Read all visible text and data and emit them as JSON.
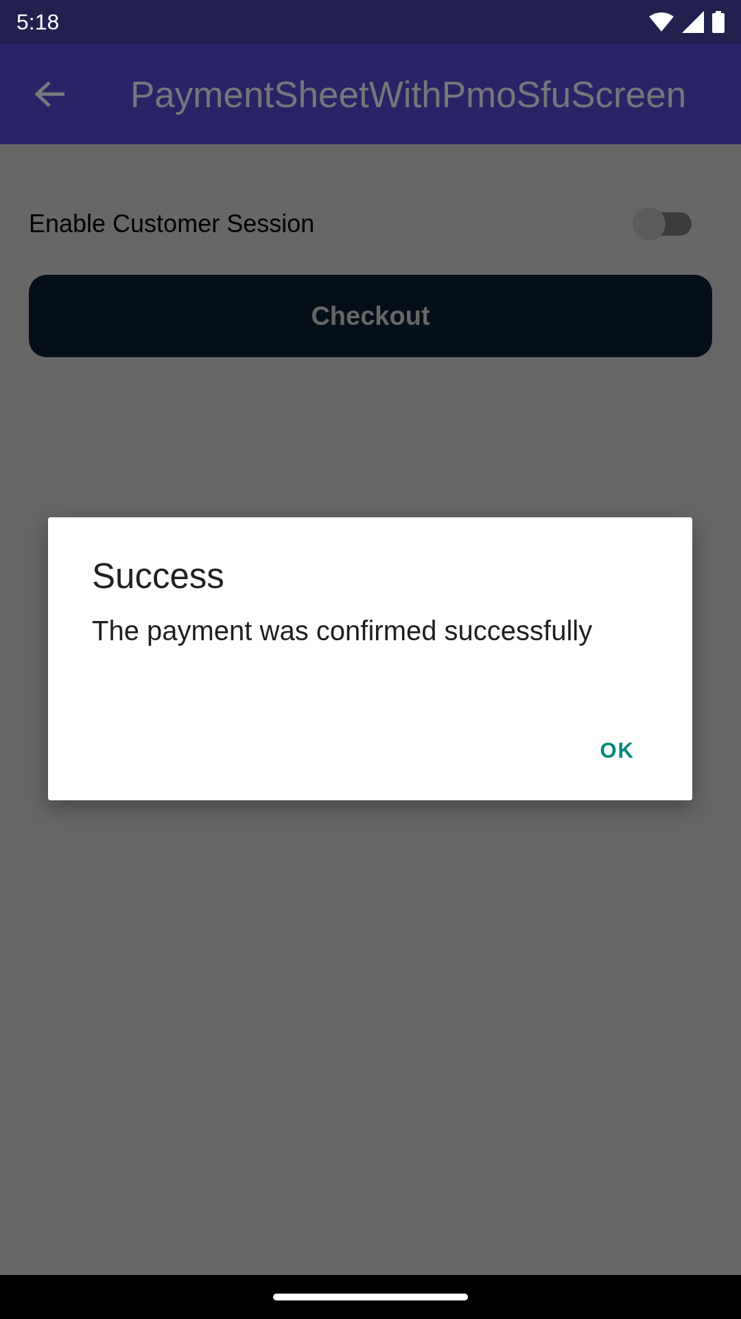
{
  "status_bar": {
    "time": "5:18"
  },
  "app_bar": {
    "title": "PaymentSheetWithPmoSfuScreen"
  },
  "settings": [
    {
      "label": "Enable Customer Session",
      "on": false
    }
  ],
  "checkout_button": {
    "label": "Checkout"
  },
  "dialog": {
    "title": "Success",
    "message": "The payment was confirmed successfully",
    "buttons": [
      "OK"
    ]
  }
}
